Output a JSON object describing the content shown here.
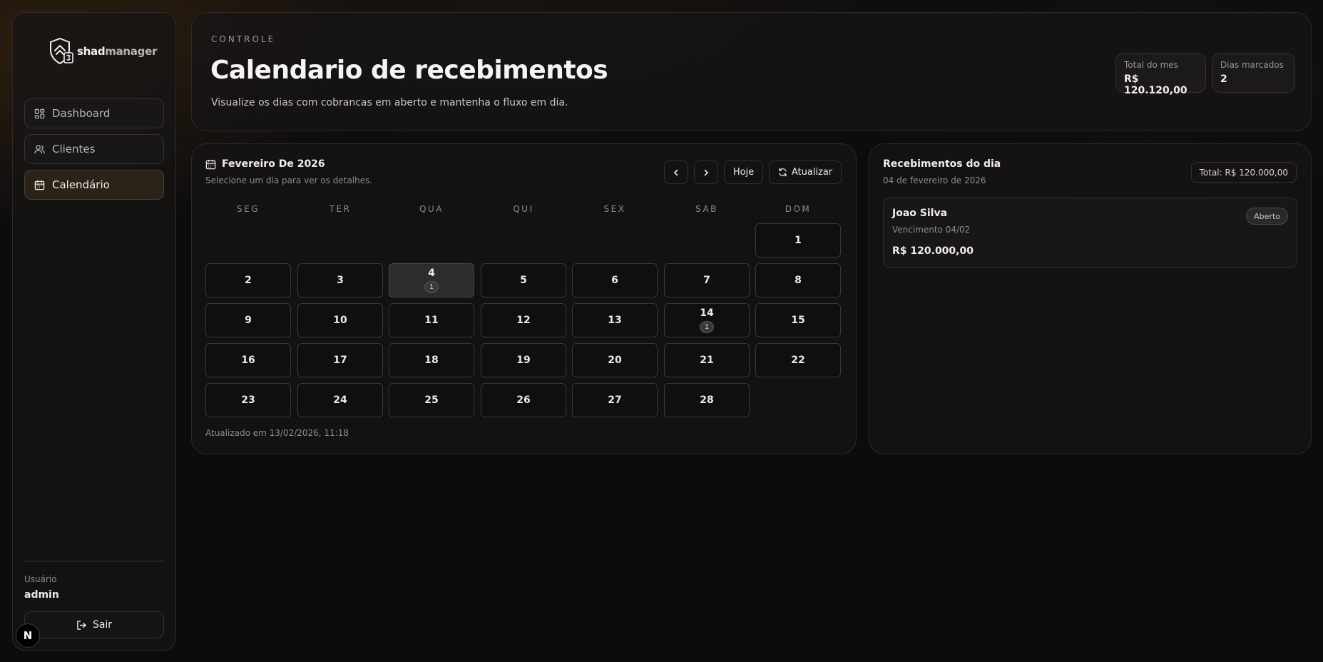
{
  "app": {
    "logo_bold": "shad",
    "logo_light": "manager"
  },
  "sidebar": {
    "items": [
      {
        "label": "Dashboard"
      },
      {
        "label": "Clientes"
      },
      {
        "label": "Calendário"
      }
    ],
    "active": "Calendário",
    "user_label": "Usuário",
    "user_name": "admin",
    "logout_label": "Sair",
    "n_badge": "N"
  },
  "header": {
    "eyebrow": "CONTROLE",
    "title": "Calendario de recebimentos",
    "subtitle": "Visualize os dias com cobrancas em aberto e mantenha o fluxo em dia.",
    "stats": [
      {
        "label": "Total do mes",
        "value": "R$ 120.120,00"
      },
      {
        "label": "Dias marcados",
        "value": "2"
      }
    ]
  },
  "calendar": {
    "title": "Fevereiro De 2026",
    "subtitle": "Selecione um dia para ver os detalhes.",
    "today_label": "Hoje",
    "refresh_label": "Atualizar",
    "weekdays": [
      "SEG",
      "TER",
      "QUA",
      "QUI",
      "SEX",
      "SAB",
      "DOM"
    ],
    "first_weekday_index": 6,
    "days_in_month": 28,
    "selected_day": 4,
    "counts": {
      "4": "1",
      "14": "1"
    },
    "updated": "Atualizado em 13/02/2026, 11:18"
  },
  "receipts": {
    "title": "Recebimentos do dia",
    "date": "04 de fevereiro de 2026",
    "total": "Total: R$ 120.000,00",
    "items": [
      {
        "name": "Joao Silva",
        "due": "Vencimento 04/02",
        "amount": "R$ 120.000,00",
        "status": "Aberto"
      }
    ]
  },
  "colors": {
    "accent_active": "#2b2219",
    "background": "#0c0c0d"
  }
}
